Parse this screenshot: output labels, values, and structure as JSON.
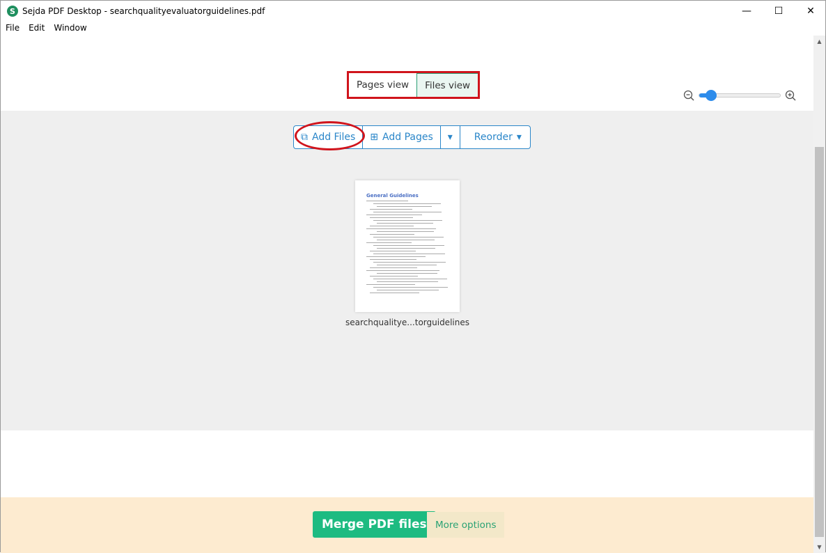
{
  "window": {
    "title": "Sejda PDF Desktop - searchqualityevaluatorguidelines.pdf",
    "logo": "S",
    "minimize": "—",
    "maximize": "☐",
    "close": "✕"
  },
  "menu": [
    "File",
    "Edit",
    "Window"
  ],
  "view_toggle": {
    "pages": "Pages view",
    "files": "Files view",
    "active": "files"
  },
  "zoom": {
    "level_percent": 15
  },
  "toolbar": {
    "add_files": "Add Files",
    "add_pages": "Add Pages",
    "reorder": "Reorder"
  },
  "file": {
    "page_title": "General Guidelines",
    "name": "searchqualitye...torguidelines"
  },
  "footer": {
    "merge": "Merge PDF files",
    "more": "More options"
  },
  "colors": {
    "accent": "#1dbb81",
    "link": "#2a86c9",
    "highlight": "#d0141c"
  }
}
